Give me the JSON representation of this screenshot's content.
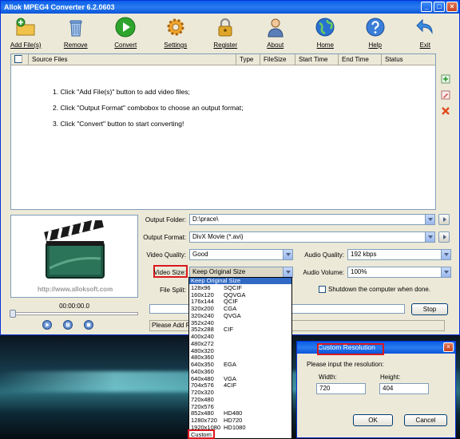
{
  "window": {
    "title": "Allok MPEG4 Converter 6.2.0603",
    "controls": [
      "_",
      "□",
      "×"
    ]
  },
  "toolbar": [
    {
      "label": "Add File(s)",
      "icon": "add-folder-icon",
      "color": "#e8b23a"
    },
    {
      "label": "Remove",
      "icon": "trash-icon",
      "color": "#5a8fd6"
    },
    {
      "label": "Convert",
      "icon": "play-icon",
      "color": "#2da52d"
    },
    {
      "label": "Settings",
      "icon": "gear-icon",
      "color": "#e89a22"
    },
    {
      "label": "Register",
      "icon": "lock-icon",
      "color": "#d6a22a"
    },
    {
      "label": "About",
      "icon": "person-icon",
      "color": "#5b7fb8"
    },
    {
      "label": "Home",
      "icon": "globe-icon",
      "color": "#2a72d0"
    },
    {
      "label": "Help",
      "icon": "help-icon",
      "color": "#3a7ed8"
    },
    {
      "label": "Exit",
      "icon": "exit-arrow-icon",
      "color": "#3b8be0"
    }
  ],
  "filelist": {
    "columns": [
      "Source Files",
      "Type",
      "FileSize",
      "Start Time",
      "End Time",
      "Status"
    ],
    "instructions": [
      "1. Click \"Add File(s)\" button to add video files;",
      "2. Click \"Output Format\" combobox to choose an output format;",
      "3. Click \"Convert\" button to start converting!"
    ]
  },
  "preview": {
    "url": "http://www.alloksoft.com",
    "timecode": "00:00:00.0"
  },
  "settings": {
    "output_folder_label": "Output Folder:",
    "output_folder_value": "D:\\prace\\",
    "output_format_label": "Output Format:",
    "output_format_value": "DivX Movie (*.avi)",
    "video_quality_label": "Video Quality:",
    "video_quality_value": "Good",
    "audio_quality_label": "Audio Quality:",
    "audio_quality_value": "192 kbps",
    "video_size_label": "Video Size:",
    "video_size_value": "Keep Original Size",
    "audio_volume_label": "Audio Volume:",
    "audio_volume_value": "100%",
    "file_split_label": "File Split:",
    "shutdown_label": "Shutdown the computer when done.",
    "stop_label": "Stop",
    "status_text": "Please Add File"
  },
  "size_options": [
    {
      "size": "Keep Original Size",
      "name": ""
    },
    {
      "size": "128x96",
      "name": "SQCIF"
    },
    {
      "size": "160x120",
      "name": "QQVGA"
    },
    {
      "size": "176x144",
      "name": "QCIF"
    },
    {
      "size": "320x200",
      "name": "CGA"
    },
    {
      "size": "320x240",
      "name": "QVGA"
    },
    {
      "size": "352x240",
      "name": ""
    },
    {
      "size": "352x288",
      "name": "CIF"
    },
    {
      "size": "400x240",
      "name": ""
    },
    {
      "size": "480x272",
      "name": ""
    },
    {
      "size": "480x320",
      "name": ""
    },
    {
      "size": "480x360",
      "name": ""
    },
    {
      "size": "640x350",
      "name": "EGA"
    },
    {
      "size": "640x360",
      "name": ""
    },
    {
      "size": "640x480",
      "name": "VGA"
    },
    {
      "size": "704x576",
      "name": "4CIF"
    },
    {
      "size": "720x320",
      "name": ""
    },
    {
      "size": "720x480",
      "name": ""
    },
    {
      "size": "720x576",
      "name": ""
    },
    {
      "size": "852x480",
      "name": "HD480"
    },
    {
      "size": "1280x720",
      "name": "HD720"
    },
    {
      "size": "1920x1080",
      "name": "HD1080"
    },
    {
      "size": "Custom",
      "name": ""
    }
  ],
  "dialog": {
    "title": "Custom Resolution",
    "prompt": "Please input the resolution:",
    "width_label": "Width:",
    "width_value": "720",
    "height_label": "Height:",
    "height_value": "404",
    "ok_label": "OK",
    "cancel_label": "Cancel"
  },
  "accent_red": "#d8191f"
}
